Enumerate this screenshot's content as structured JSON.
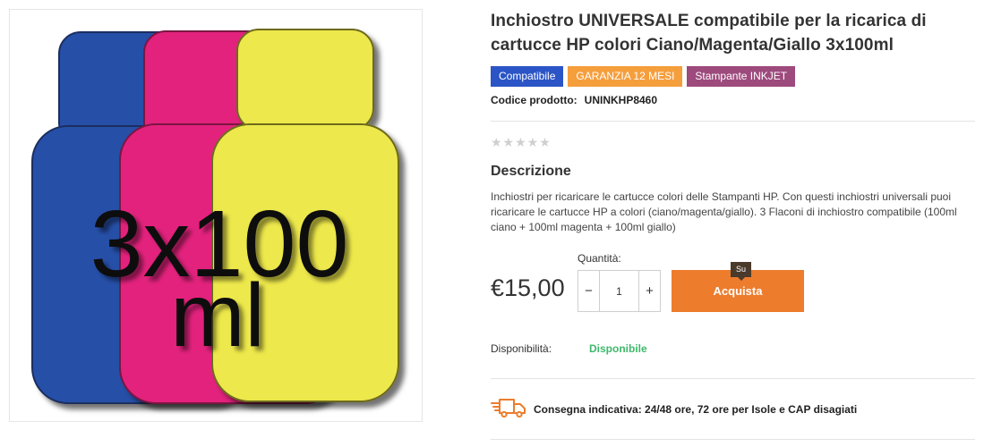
{
  "product": {
    "image_alt_text_top": "3x100",
    "image_alt_text_bottom": "ml",
    "title": "Inchiostro UNIVERSALE compatibile per la ricarica di cartucce HP colori Ciano/Magenta/Giallo 3x100ml",
    "badges": [
      {
        "label": "Compatibile",
        "color": "#2b55c6"
      },
      {
        "label": "GARANZIA 12 MESI",
        "color": "#f59e3c"
      },
      {
        "label": "Stampante INKJET",
        "color": "#9d4a7d"
      }
    ],
    "code_label": "Codice prodotto:",
    "code_value": "UNINKHP8460",
    "rating_stars": "★★★★★",
    "rating_value": 0,
    "description_heading": "Descrizione",
    "description_text": "Inchiostri per ricaricare le cartucce colori delle Stampanti HP. Con questi inchiostri universali puoi ricaricare le cartucce HP a colori (ciano/magenta/giallo). 3 Flaconi di inchiostro compatibile (100ml ciano + 100ml magenta + 100ml giallo)"
  },
  "purchase": {
    "price": "€15,00",
    "quantity_label": "Quantità:",
    "quantity_value": "1",
    "minus_label": "−",
    "plus_label": "+",
    "buy_label": "Acquista",
    "tooltip": "Su",
    "accent_color": "#ed7c2c"
  },
  "availability": {
    "label": "Disponibilità:",
    "value": "Disponibile",
    "value_color": "#3fb86b"
  },
  "delivery": {
    "icon": "delivery-truck-icon",
    "text": "Consegna indicativa: 24/48 ore, 72 ore per Isole e CAP disagiati"
  }
}
